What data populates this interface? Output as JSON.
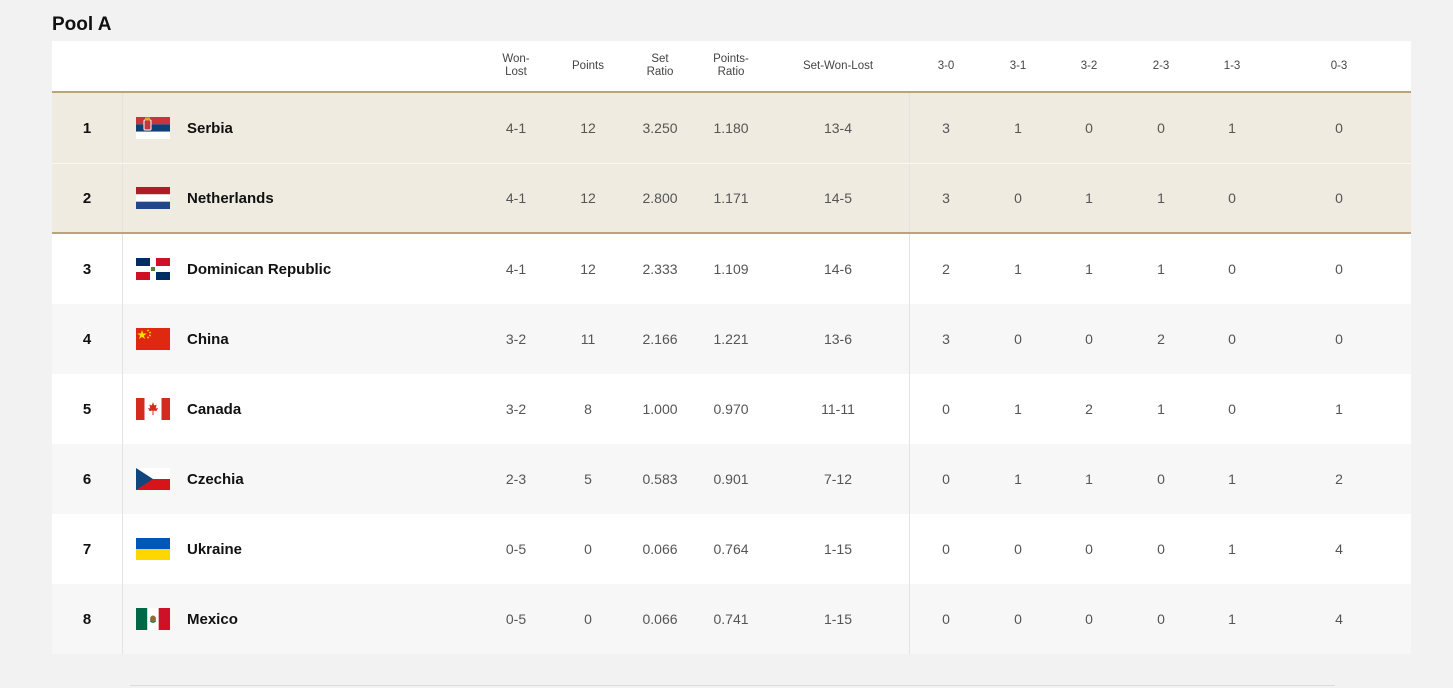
{
  "pool": {
    "title": "Pool A"
  },
  "headers": {
    "won_lost": "Won-Lost",
    "points": "Points",
    "set_ratio": "Set Ratio",
    "points_ratio": "Points-Ratio",
    "set_won_lost": "Set-Won-Lost",
    "r30": "3-0",
    "r31": "3-1",
    "r32": "3-2",
    "r23": "2-3",
    "r13": "1-3",
    "r03": "0-3"
  },
  "rows": [
    {
      "rank": "1",
      "team": "Serbia",
      "flag": "serbia-flag-icon",
      "won_lost": "4-1",
      "points": "12",
      "set_ratio": "3.250",
      "points_ratio": "1.180",
      "set_won_lost": "13-4",
      "r30": "3",
      "r31": "1",
      "r32": "0",
      "r23": "0",
      "r13": "1",
      "r03": "0"
    },
    {
      "rank": "2",
      "team": "Netherlands",
      "flag": "netherlands-flag-icon",
      "won_lost": "4-1",
      "points": "12",
      "set_ratio": "2.800",
      "points_ratio": "1.171",
      "set_won_lost": "14-5",
      "r30": "3",
      "r31": "0",
      "r32": "1",
      "r23": "1",
      "r13": "0",
      "r03": "0"
    },
    {
      "rank": "3",
      "team": "Dominican Republic",
      "flag": "dominican-republic-flag-icon",
      "won_lost": "4-1",
      "points": "12",
      "set_ratio": "2.333",
      "points_ratio": "1.109",
      "set_won_lost": "14-6",
      "r30": "2",
      "r31": "1",
      "r32": "1",
      "r23": "1",
      "r13": "0",
      "r03": "0"
    },
    {
      "rank": "4",
      "team": "China",
      "flag": "china-flag-icon",
      "won_lost": "3-2",
      "points": "11",
      "set_ratio": "2.166",
      "points_ratio": "1.221",
      "set_won_lost": "13-6",
      "r30": "3",
      "r31": "0",
      "r32": "0",
      "r23": "2",
      "r13": "0",
      "r03": "0"
    },
    {
      "rank": "5",
      "team": "Canada",
      "flag": "canada-flag-icon",
      "won_lost": "3-2",
      "points": "8",
      "set_ratio": "1.000",
      "points_ratio": "0.970",
      "set_won_lost": "11-11",
      "r30": "0",
      "r31": "1",
      "r32": "2",
      "r23": "1",
      "r13": "0",
      "r03": "1"
    },
    {
      "rank": "6",
      "team": "Czechia",
      "flag": "czechia-flag-icon",
      "won_lost": "2-3",
      "points": "5",
      "set_ratio": "0.583",
      "points_ratio": "0.901",
      "set_won_lost": "7-12",
      "r30": "0",
      "r31": "1",
      "r32": "1",
      "r23": "0",
      "r13": "1",
      "r03": "2"
    },
    {
      "rank": "7",
      "team": "Ukraine",
      "flag": "ukraine-flag-icon",
      "won_lost": "0-5",
      "points": "0",
      "set_ratio": "0.066",
      "points_ratio": "0.764",
      "set_won_lost": "1-15",
      "r30": "0",
      "r31": "0",
      "r32": "0",
      "r23": "0",
      "r13": "1",
      "r03": "4"
    },
    {
      "rank": "8",
      "team": "Mexico",
      "flag": "mexico-flag-icon",
      "won_lost": "0-5",
      "points": "0",
      "set_ratio": "0.066",
      "points_ratio": "0.741",
      "set_won_lost": "1-15",
      "r30": "0",
      "r31": "0",
      "r32": "0",
      "r23": "0",
      "r13": "1",
      "r03": "4"
    }
  ],
  "colors": {
    "qualified_row": "#efebe0",
    "qualified_line": "#b8a57a",
    "page_bg": "#f2f2f2"
  }
}
